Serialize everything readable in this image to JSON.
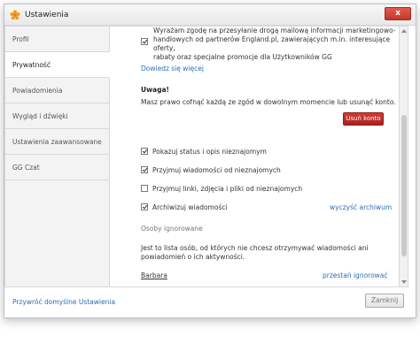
{
  "window": {
    "title": "Ustawienia",
    "close_symbol": "x"
  },
  "sidebar": {
    "items": [
      {
        "label": "Profil"
      },
      {
        "label": "Prywatność"
      },
      {
        "label": "Powiadomienia"
      },
      {
        "label": "Wygląd i dźwięki"
      },
      {
        "label": "Ustawienia zaawansowane"
      },
      {
        "label": "GG Czat"
      }
    ],
    "active_index": 1
  },
  "content": {
    "marketing_consent": {
      "checked": true,
      "text": "Wyrażam zgodę na przesyłanie drogą mailową informacji marketingowo-\nhandlowych od partnerów England.pl, zawierających m.in. interesujące oferty,\nrabaty oraz specjalne promocje dla Użytkowników GG"
    },
    "learn_more_link": "Dowiedz się więcej",
    "warning": {
      "title": "Uwaga!",
      "text": "Masz prawo cofnąć każdą ze zgód w dowolnym momencie lub usunąć konto."
    },
    "delete_account_button": "Usuń konto",
    "options": [
      {
        "label": "Pokazuj status i opis nieznajomym",
        "checked": true
      },
      {
        "label": "Przyjmuj wiadomości od nieznajomych",
        "checked": true
      },
      {
        "label": "Przyjmuj linki, zdjęcia i pliki od nieznajomych",
        "checked": false
      },
      {
        "label": "Archiwizuj wiadomości",
        "checked": true
      }
    ],
    "clear_archive_link": "wyczyść archiwum",
    "ignored": {
      "heading": "Osoby ignorowane",
      "description": "Jest to lista osób, od których nie chcesz otrzymywać wiadomości ani\npowiadomień o ich aktywności.",
      "entries": [
        {
          "name": "Barbara",
          "action": "przestań ignorować"
        }
      ]
    }
  },
  "footer": {
    "restore_defaults_link": "Przywróć domyślne Ustawienia",
    "close_button": "Zamknij"
  }
}
